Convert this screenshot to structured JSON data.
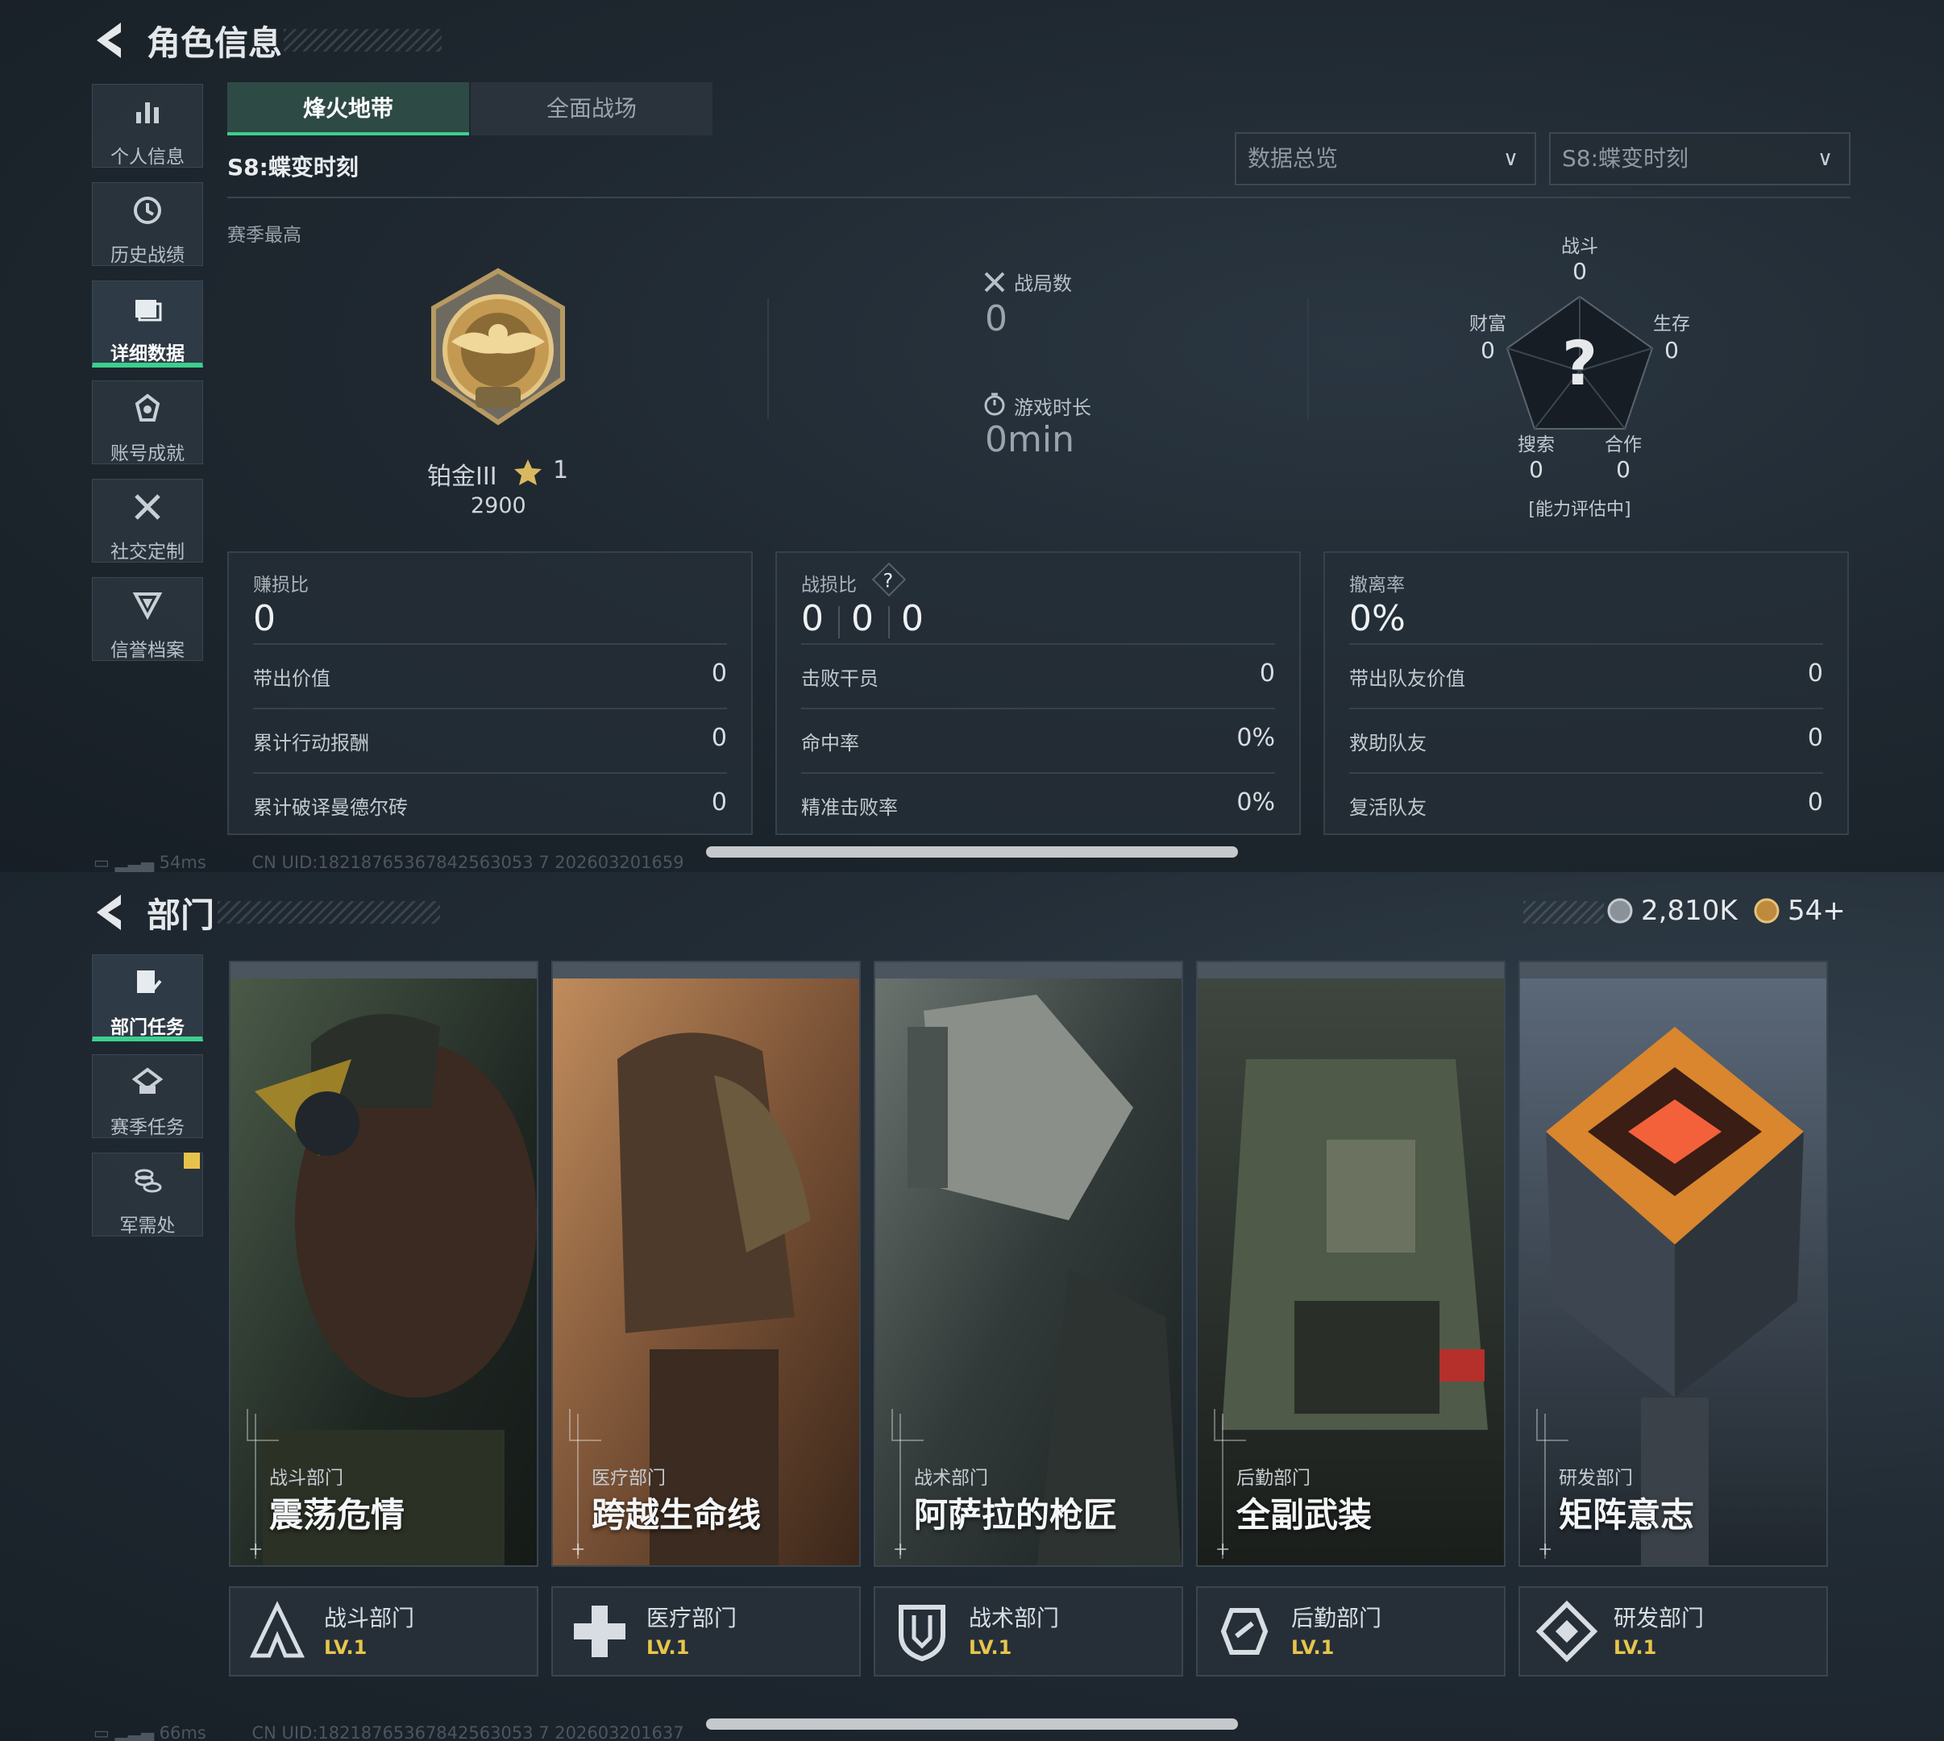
{
  "panel1": {
    "title": "角色信息",
    "sidebar": [
      {
        "label": "个人信息",
        "icon": "bar-chart-icon"
      },
      {
        "label": "历史战绩",
        "icon": "clock-icon"
      },
      {
        "label": "详细数据",
        "icon": "folder-icon",
        "active": true
      },
      {
        "label": "账号成就",
        "icon": "medal-icon"
      },
      {
        "label": "社交定制",
        "icon": "tools-icon"
      },
      {
        "label": "信誉档案",
        "icon": "shield-icon"
      }
    ],
    "tabs": [
      "烽火地带",
      "全面战场"
    ],
    "active_tab": "烽火地带",
    "season_title": "S8:蝶变时刻",
    "dropdown_overview": "数据总览",
    "dropdown_season": "S8:蝶变时刻",
    "season_best_label": "赛季最高",
    "rank": {
      "name": "铂金III",
      "stars": "1",
      "score": "2900"
    },
    "matches": {
      "label": "战局数",
      "value": "0"
    },
    "playtime": {
      "label": "游戏时长",
      "value": "0min"
    },
    "radar": {
      "combat": {
        "label": "战斗",
        "value": "0"
      },
      "survival": {
        "label": "生存",
        "value": "0"
      },
      "cooperation": {
        "label": "合作",
        "value": "0"
      },
      "search": {
        "label": "搜索",
        "value": "0"
      },
      "wealth": {
        "label": "财富",
        "value": "0"
      },
      "center": "?",
      "status": "[能力评估中]"
    },
    "cards": [
      {
        "title": "赚损比",
        "value": "0",
        "rows": [
          {
            "label": "带出价值",
            "value": "0"
          },
          {
            "label": "累计行动报酬",
            "value": "0"
          },
          {
            "label": "累计破译曼德尔砖",
            "value": "0"
          }
        ]
      },
      {
        "title": "战损比",
        "help": "?",
        "values": [
          "0",
          "0",
          "0"
        ],
        "rows": [
          {
            "label": "击败干员",
            "value": "0"
          },
          {
            "label": "命中率",
            "value": "0%"
          },
          {
            "label": "精准击败率",
            "value": "0%"
          }
        ]
      },
      {
        "title": "撤离率",
        "value": "0%",
        "rows": [
          {
            "label": "带出队友价值",
            "value": "0"
          },
          {
            "label": "救助队友",
            "value": "0"
          },
          {
            "label": "复活队友",
            "value": "0"
          }
        ]
      }
    ],
    "status_bar": {
      "ping": "54ms",
      "uid": "CN UID:18218765367842563053 7 202603201659"
    }
  },
  "panel2": {
    "title": "部门",
    "currency1": "2,810K",
    "currency2": "54+",
    "sidebar": [
      {
        "label": "部门任务",
        "icon": "task-icon",
        "active": true
      },
      {
        "label": "赛季任务",
        "icon": "season-task-icon"
      },
      {
        "label": "军需处",
        "icon": "coins-icon"
      }
    ],
    "departments": [
      {
        "sub": "战斗部门",
        "name": "震荡危情",
        "dept": "战斗部门",
        "level": "LV.1",
        "colors": [
          "#3a4a3a",
          "#1b231f",
          "#6b5a3a"
        ]
      },
      {
        "sub": "医疗部门",
        "name": "跨越生命线",
        "dept": "医疗部门",
        "level": "LV.1",
        "colors": [
          "#b58457",
          "#5b3e2b",
          "#2b2019"
        ]
      },
      {
        "sub": "战术部门",
        "name": "阿萨拉的枪匠",
        "dept": "战术部门",
        "level": "LV.1",
        "colors": [
          "#5c6560",
          "#2a302f",
          "#1b1f20"
        ]
      },
      {
        "sub": "后勤部门",
        "name": "全副武装",
        "dept": "后勤部门",
        "level": "LV.1",
        "colors": [
          "#4a5345",
          "#252b26",
          "#171b18"
        ]
      },
      {
        "sub": "研发部门",
        "name": "矩阵意志",
        "dept": "研发部门",
        "level": "LV.1",
        "colors": [
          "#4c5968",
          "#2b323a",
          "#e2653a"
        ]
      }
    ],
    "status_bar": {
      "ping": "66ms",
      "uid": "CN UID:18218765367842563053 7 202603201637"
    }
  }
}
